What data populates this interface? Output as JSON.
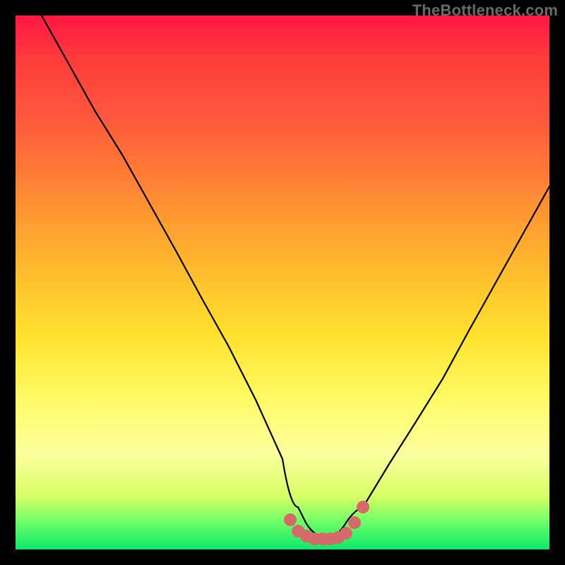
{
  "watermark": "TheBottleneck.com",
  "chart_data": {
    "type": "line",
    "title": "",
    "xlabel": "",
    "ylabel": "",
    "xlim": [
      0,
      100
    ],
    "ylim": [
      0,
      100
    ],
    "grid": false,
    "legend": false,
    "background": "vertical-gradient-red-to-green",
    "note": "Axes unlabeled in source image; x and y expressed as 0–100 percent of plot area. Curve is a V-shaped bottleneck curve with minimum near x≈53–62, y≈2.",
    "series": [
      {
        "name": "bottleneck-curve",
        "color": "#000000",
        "x": [
          5,
          10,
          15,
          20,
          25,
          30,
          35,
          40,
          45,
          50,
          53,
          56,
          59,
          62,
          65,
          70,
          75,
          80,
          85,
          90,
          95,
          100
        ],
        "y": [
          100,
          91,
          82,
          74,
          65,
          56,
          47,
          38,
          28,
          17,
          8,
          3,
          2,
          3,
          8,
          16,
          24,
          32,
          41,
          50,
          59,
          68
        ]
      },
      {
        "name": "highlight-dots",
        "color": "#d66a6a",
        "type": "scatter",
        "x": [
          51.5,
          53,
          54.5,
          56,
          57.5,
          59,
          60.5,
          62,
          63.5,
          65
        ],
        "y": [
          5.5,
          3.5,
          2.5,
          2,
          2,
          2,
          2.3,
          3,
          5,
          8
        ],
        "marker_radius_px": 8
      }
    ]
  }
}
